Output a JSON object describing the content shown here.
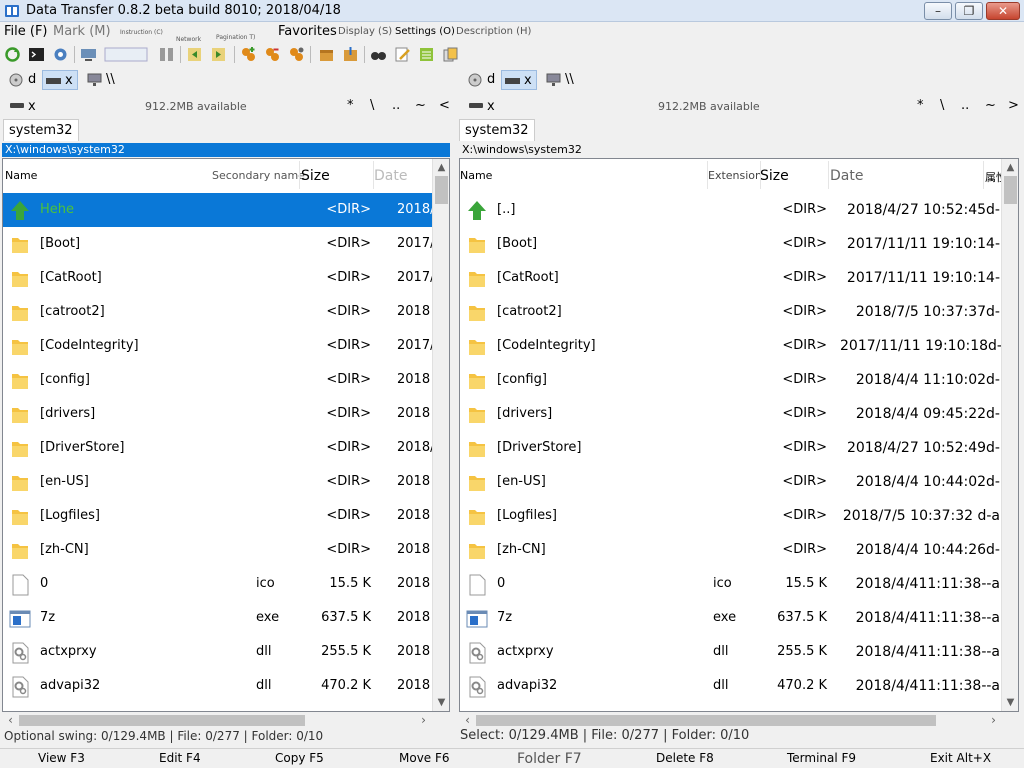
{
  "window": {
    "title": "Data Transfer 0.8.2 beta build 8010; 2018/04/18",
    "min": "–",
    "max": "❐",
    "close": "✕"
  },
  "menu": {
    "file": "File (F)",
    "mark": "Mark (M)",
    "instruction": "Instruction (C)",
    "network": "Network",
    "pagination": "Pagination T)",
    "favorites": "Favorites",
    "display": "Display (S)",
    "settings": "Settings (O)",
    "description": "Description (H)"
  },
  "left": {
    "drives": [
      {
        "label": "d",
        "icon": "disk-icon"
      },
      {
        "label": "x",
        "icon": "drive-icon"
      },
      {
        "label": "\\\\",
        "icon": "network-icon"
      }
    ],
    "drive_name": "x",
    "available": "912.2MB available",
    "nav": [
      "*",
      "\\",
      "..",
      "~",
      "<"
    ],
    "tab": "system32",
    "path": "X:\\windows\\system32",
    "header": {
      "name": "Name",
      "secondary": "Secondary name",
      "size": "Size",
      "date": "Date"
    },
    "rows": [
      {
        "icon": "up",
        "name": "Hehe",
        "ext": "",
        "size": "<DIR>",
        "date": "2018/"
      },
      {
        "icon": "folder",
        "name": "[Boot]",
        "ext": "",
        "size": "<DIR>",
        "date": "2017/1"
      },
      {
        "icon": "folder",
        "name": "[CatRoot]",
        "ext": "",
        "size": "<DIR>",
        "date": "2017/1"
      },
      {
        "icon": "folder",
        "name": "[catroot2]",
        "ext": "",
        "size": "<DIR>",
        "date": "2018"
      },
      {
        "icon": "folder",
        "name": "[CodeIntegrity]",
        "ext": "",
        "size": "<DIR>",
        "date": "2017/1"
      },
      {
        "icon": "folder",
        "name": "[config]",
        "ext": "",
        "size": "<DIR>",
        "date": "2018"
      },
      {
        "icon": "folder",
        "name": "[drivers]",
        "ext": "",
        "size": "<DIR>",
        "date": "2018"
      },
      {
        "icon": "folder",
        "name": "[DriverStore]",
        "ext": "",
        "size": "<DIR>",
        "date": "2018/"
      },
      {
        "icon": "folder",
        "name": "[en-US]",
        "ext": "",
        "size": "<DIR>",
        "date": "2018"
      },
      {
        "icon": "folder",
        "name": "[Logfiles]",
        "ext": "",
        "size": "<DIR>",
        "date": "2018"
      },
      {
        "icon": "folder",
        "name": "[zh-CN]",
        "ext": "",
        "size": "<DIR>",
        "date": "2018"
      },
      {
        "icon": "file",
        "name": "0",
        "ext": "ico",
        "size": "15.5 K",
        "date": "2018"
      },
      {
        "icon": "exe",
        "name": "7z",
        "ext": "exe",
        "size": "637.5 K",
        "date": "2018"
      },
      {
        "icon": "dll",
        "name": "actxprxy",
        "ext": "dll",
        "size": "255.5 K",
        "date": "2018"
      },
      {
        "icon": "dll",
        "name": "advapi32",
        "ext": "dll",
        "size": "470.2 K",
        "date": "2018"
      }
    ],
    "status": "Optional swing: 0/129.4MB | File: 0/277 | Folder: 0/10"
  },
  "right": {
    "drives": [
      {
        "label": "d",
        "icon": "disk-icon"
      },
      {
        "label": "x",
        "icon": "drive-icon"
      },
      {
        "label": "\\\\",
        "icon": "network-icon"
      }
    ],
    "drive_name": "x",
    "available": "912.2MB available",
    "nav": [
      "*",
      "\\",
      "..",
      "~",
      ">"
    ],
    "tab": "system32",
    "path": "X:\\windows\\system32",
    "header": {
      "name": "Name",
      "ext": "Extension",
      "size": "Size",
      "date": "Date",
      "attr": "属性"
    },
    "rows": [
      {
        "icon": "up",
        "name": "[..]",
        "ext": "",
        "size": "<DIR>",
        "date": "2018/4/27 10:52:45d-"
      },
      {
        "icon": "folder",
        "name": "[Boot]",
        "ext": "",
        "size": "<DIR>",
        "date": "2017/11/11 19:10:14-"
      },
      {
        "icon": "folder",
        "name": "[CatRoot]",
        "ext": "",
        "size": "<DIR>",
        "date": "2017/11/11 19:10:14-"
      },
      {
        "icon": "folder",
        "name": "[catroot2]",
        "ext": "",
        "size": "<DIR>",
        "date": "2018/7/5 10:37:37d-"
      },
      {
        "icon": "folder",
        "name": "[CodeIntegrity]",
        "ext": "",
        "size": "<DIR>",
        "date": "2017/11/11 19:10:18d-"
      },
      {
        "icon": "folder",
        "name": "[config]",
        "ext": "",
        "size": "<DIR>",
        "date": "2018/4/4 11:10:02d-"
      },
      {
        "icon": "folder",
        "name": "[drivers]",
        "ext": "",
        "size": "<DIR>",
        "date": "2018/4/4 09:45:22d-"
      },
      {
        "icon": "folder",
        "name": "[DriverStore]",
        "ext": "",
        "size": "<DIR>",
        "date": "2018/4/27 10:52:49d-"
      },
      {
        "icon": "folder",
        "name": "[en-US]",
        "ext": "",
        "size": "<DIR>",
        "date": "2018/4/4 10:44:02d-"
      },
      {
        "icon": "folder",
        "name": "[Logfiles]",
        "ext": "",
        "size": "<DIR>",
        "date": "2018/7/5 10:37:32 d-a"
      },
      {
        "icon": "folder",
        "name": "[zh-CN]",
        "ext": "",
        "size": "<DIR>",
        "date": "2018/4/4 10:44:26d-"
      },
      {
        "icon": "file",
        "name": "0",
        "ext": "ico",
        "size": "15.5 K",
        "date": "2018/4/411:11:38--a"
      },
      {
        "icon": "exe",
        "name": "7z",
        "ext": "exe",
        "size": "637.5 K",
        "date": "2018/4/411:11:38--a"
      },
      {
        "icon": "dll",
        "name": "actxprxy",
        "ext": "dll",
        "size": "255.5 K",
        "date": "2018/4/411:11:38--a"
      },
      {
        "icon": "dll",
        "name": "advapi32",
        "ext": "dll",
        "size": "470.2 K",
        "date": "2018/4/411:11:38--a"
      }
    ],
    "status": "Select: 0/129.4MB | File: 0/277 | Folder: 0/10"
  },
  "fkeys": {
    "view": "View F3",
    "edit": "Edit F4",
    "copy": "Copy F5",
    "move": "Move F6",
    "folder": "Folder F7",
    "delete": "Delete F8",
    "terminal": "Terminal F9",
    "exit": "Exit Alt+X"
  },
  "colors": {
    "selection": "#0a78d7",
    "folder": "#f5c342",
    "up_arrow": "#3aa53a",
    "titlebar": "#dbe6f4"
  }
}
